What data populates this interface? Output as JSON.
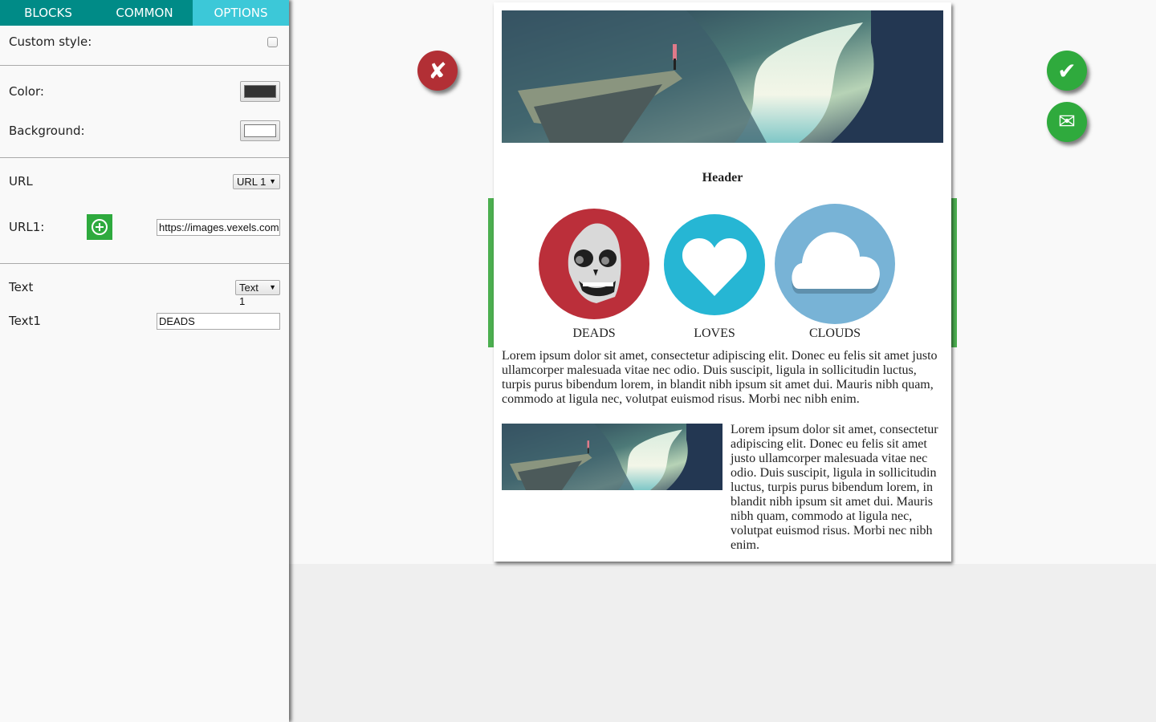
{
  "sidebar": {
    "tabs": [
      {
        "label": "BLOCKS",
        "active": false
      },
      {
        "label": "COMMON",
        "active": false
      },
      {
        "label": "OPTIONS",
        "active": true
      }
    ],
    "custom_style_label": "Custom style:",
    "custom_style_checked": false,
    "color_label": "Color:",
    "color_value": "#333333",
    "background_label": "Background:",
    "background_value": "#ffffff",
    "url_label": "URL",
    "url_select_value": "URL 1",
    "url1_label": "URL1:",
    "url1_value": "https://images.vexels.com",
    "text_label": "Text",
    "text_select_value": "Text 1",
    "text1_label": "Text1",
    "text1_value": "DEADS"
  },
  "actions": {
    "close_icon": "✘",
    "ok_icon": "✔",
    "mail_icon": "✉"
  },
  "email": {
    "header": "Header",
    "icons": [
      {
        "caption": "DEADS",
        "icon": "skull",
        "color": "#bb2f3a"
      },
      {
        "caption": "LOVES",
        "icon": "heart",
        "color": "#26b6d4"
      },
      {
        "caption": "CLOUDS",
        "icon": "cloud",
        "color": "#78b3d6"
      }
    ],
    "paragraph": "Lorem ipsum dolor sit amet, consectetur adipiscing elit. Donec eu felis sit amet justo ullamcorper malesuada vitae nec odio. Duis suscipit, ligula in sollicitudin luctus, turpis purus bibendum lorem, in blandit nibh ipsum sit amet dui. Mauris nibh quam, commodo at ligula nec, volutpat euismod risus. Morbi nec nibh enim.",
    "side_paragraph": "Lorem ipsum dolor sit amet, consectetur adipiscing elit. Donec eu felis sit amet justo ullamcorper malesuada vitae nec odio. Duis suscipit, ligula in sollicitudin luctus, turpis purus bibendum lorem, in blandit nibh ipsum sit amet dui. Mauris nibh quam, commodo at ligula nec, volutpat euismod risus. Morbi nec nibh enim."
  },
  "colors": {
    "tab_bg": "#008b87",
    "tab_active_bg": "#3cc8d8",
    "add_button": "#2eaa3e",
    "selection_frame": "#4caf50"
  }
}
